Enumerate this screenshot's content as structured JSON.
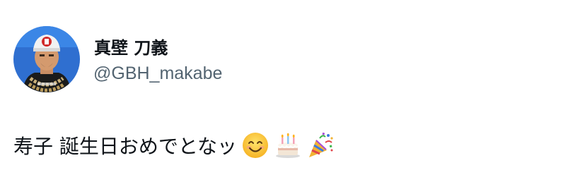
{
  "author": {
    "display_name": "真壁 刀義",
    "handle": "@GBH_makabe"
  },
  "tweet": {
    "text": "寿子 誕生日おめでとなッ",
    "emojis": [
      "smiling-face-emoji",
      "birthday-cake-emoji",
      "party-popper-emoji"
    ]
  },
  "colors": {
    "text": "#0f1419",
    "handle": "#536471",
    "avatar_bg": "#2f6fd0"
  }
}
